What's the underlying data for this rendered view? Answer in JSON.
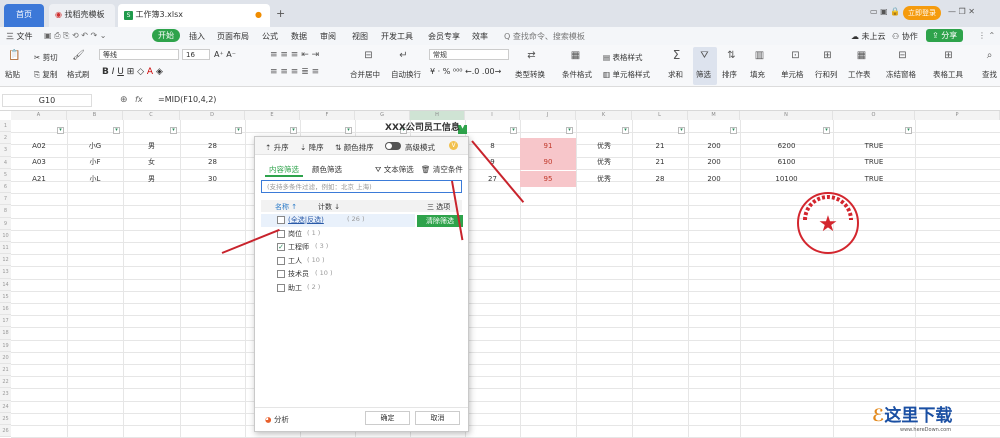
{
  "tabs": {
    "home": "首页",
    "template": "找稻壳模板",
    "file": "工作簿3.xlsx",
    "login": "立即登录"
  },
  "menu": {
    "file": "三 文件",
    "start": "开始",
    "insert": "插入",
    "layout": "页面布局",
    "formula": "公式",
    "data": "数据",
    "review": "审阅",
    "view": "视图",
    "dev": "开发工具",
    "member": "会员专享",
    "efficiency": "效率",
    "search": "Q 查找命令、搜索模板",
    "cloud": "未上云",
    "coop": "协作",
    "share": "分享"
  },
  "ribbon": {
    "cut": "剪切",
    "copy": "复制",
    "paste": "粘贴",
    "painter": "格式刷",
    "font": "等线",
    "size": "16",
    "merge": "合并居中",
    "wrap": "自动换行",
    "numfmt": "常规",
    "convert": "类型转换",
    "condfmt": "条件格式",
    "tablestyle": "表格样式",
    "cellstyle": "单元格样式",
    "sum": "求和",
    "filter": "筛选",
    "sort": "排序",
    "fill": "填充",
    "cells": "单元格",
    "rowcol": "行和列",
    "sheet": "工作表",
    "freeze": "冻结窗格",
    "tools": "表格工具",
    "find": "查找"
  },
  "formula": {
    "cellref": "G10",
    "fx": "fx",
    "value": "=MID(F10,4,2)"
  },
  "columns": [
    "A",
    "B",
    "C",
    "D",
    "E",
    "F",
    "G",
    "H",
    "I",
    "J",
    "K",
    "L",
    "M",
    "N",
    "O",
    "P"
  ],
  "rows": [
    "1",
    "2",
    "3",
    "4",
    "5",
    "6",
    "7",
    "8",
    "9",
    "10",
    "11",
    "12",
    "13",
    "14",
    "15",
    "16",
    "17",
    "18",
    "19",
    "20",
    "21",
    "22",
    "23",
    "24",
    "25",
    "26"
  ],
  "title": "XXX公司员工信息",
  "data_rows": [
    {
      "row": "4",
      "a": "A02",
      "b": "小G",
      "c": "男",
      "d": "28",
      "i": "8",
      "j": "91",
      "k": "优秀",
      "l": "21",
      "m": "200",
      "n": "6200",
      "o": "TRUE"
    },
    {
      "row": "5",
      "a": "A03",
      "b": "小F",
      "c": "女",
      "d": "28",
      "i": "9",
      "j": "90",
      "k": "优秀",
      "l": "21",
      "m": "200",
      "n": "6100",
      "o": "TRUE"
    },
    {
      "row": "23",
      "a": "A21",
      "b": "小L",
      "c": "男",
      "d": "30",
      "i": "27",
      "j": "95",
      "k": "优秀",
      "l": "28",
      "m": "200",
      "n": "10100",
      "o": "TRUE"
    }
  ],
  "panel": {
    "asc": "升序",
    "desc": "降序",
    "colorsort": "颜色排序",
    "advanced": "高级模式",
    "tab_content": "内容筛选",
    "tab_color": "颜色筛选",
    "textfilter": "文本筛选",
    "clear": "清空条件",
    "search_placeholder": "(支持多条件过滤，例如：北京 上海)",
    "col_name": "名称 ↑",
    "col_count": "计数 ↓",
    "options": "三 选项",
    "items": [
      {
        "label": "(全选|反选)",
        "count": "( 26 )",
        "checked": false
      },
      {
        "label": "岗位",
        "count": "( 1 )",
        "checked": false
      },
      {
        "label": "工程师",
        "count": "( 3 )",
        "checked": true
      },
      {
        "label": "工人",
        "count": "( 10 )",
        "checked": false
      },
      {
        "label": "技术员",
        "count": "( 10 )",
        "checked": false
      },
      {
        "label": "助工",
        "count": "( 2 )",
        "checked": false
      }
    ],
    "clear_filter": "清除筛选",
    "analyze": "分析",
    "ok": "确定",
    "cancel": "取消"
  },
  "colors": {
    "accent": "#2ea34b",
    "pink": "#f7c6ca",
    "arrow": "#c8232c",
    "stamp": "#d3262e"
  }
}
